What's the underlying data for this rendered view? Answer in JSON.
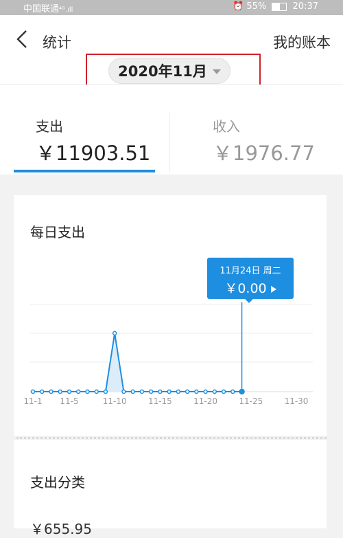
{
  "status_bar": {
    "carrier": "中国联通",
    "signal": "⁴ᴳ.ıll",
    "battery": "55%",
    "time": "20:37"
  },
  "header": {
    "title": "统计",
    "right_link": "我的账本"
  },
  "month_selector": {
    "value": "2020年11月"
  },
  "tabs": [
    {
      "label": "支出",
      "amount": "￥11903.51",
      "active": true
    },
    {
      "label": "收入",
      "amount": "￥1976.77",
      "active": false
    }
  ],
  "daily_card": {
    "title": "每日支出"
  },
  "tooltip": {
    "date": "11月24日 周二",
    "value": "￥0.00"
  },
  "category_card": {
    "title": "支出分类",
    "first_amount": "￥655.95"
  },
  "colors": {
    "accent": "#1e8ee0",
    "highlight_box": "#d0222b"
  },
  "chart_data": {
    "type": "line",
    "x_ticks": [
      "11-1",
      "11-5",
      "11-10",
      "11-15",
      "11-20",
      "11-25",
      "11-30"
    ],
    "x": [
      1,
      2,
      3,
      4,
      5,
      6,
      7,
      8,
      9,
      10,
      11,
      12,
      13,
      14,
      15,
      16,
      17,
      18,
      19,
      20,
      21,
      22,
      23,
      24
    ],
    "series": [
      {
        "values": [
          0,
          0,
          0,
          0,
          0,
          0,
          0,
          0,
          0,
          4500,
          0,
          0,
          0,
          0,
          0,
          0,
          0,
          0,
          0,
          0,
          0,
          0,
          0,
          0
        ]
      }
    ],
    "selected_x": 24,
    "ylim": [
      0,
      9000
    ],
    "grid": true
  }
}
